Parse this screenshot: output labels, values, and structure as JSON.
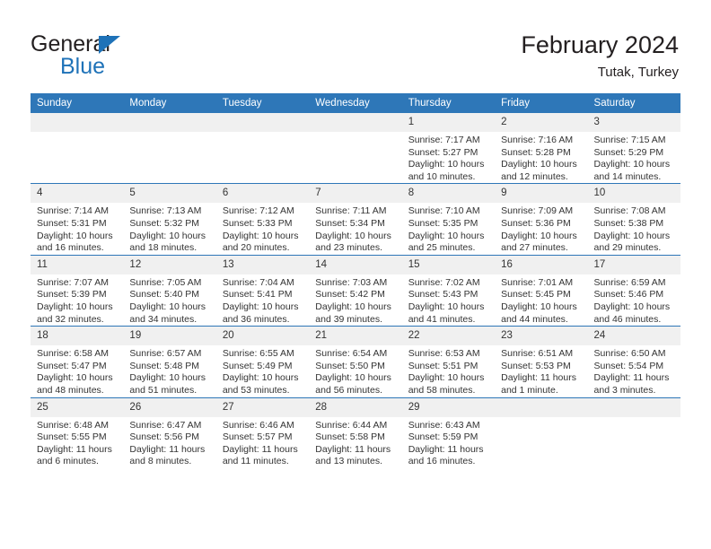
{
  "brand": {
    "name_top": "General",
    "name_bottom": "Blue"
  },
  "header": {
    "title": "February 2024",
    "subtitle": "Tutak, Turkey"
  },
  "colors": {
    "header_blue": "#2E77B8",
    "brand_blue": "#1E72B8",
    "daynum_band": "#F0F0F0",
    "text": "#333333"
  },
  "calendar": {
    "weekday_headers": [
      "Sunday",
      "Monday",
      "Tuesday",
      "Wednesday",
      "Thursday",
      "Friday",
      "Saturday"
    ],
    "weeks": [
      [
        {
          "day": "",
          "lines": []
        },
        {
          "day": "",
          "lines": []
        },
        {
          "day": "",
          "lines": []
        },
        {
          "day": "",
          "lines": []
        },
        {
          "day": "1",
          "lines": [
            "Sunrise: 7:17 AM",
            "Sunset: 5:27 PM",
            "Daylight: 10 hours",
            "and 10 minutes."
          ]
        },
        {
          "day": "2",
          "lines": [
            "Sunrise: 7:16 AM",
            "Sunset: 5:28 PM",
            "Daylight: 10 hours",
            "and 12 minutes."
          ]
        },
        {
          "day": "3",
          "lines": [
            "Sunrise: 7:15 AM",
            "Sunset: 5:29 PM",
            "Daylight: 10 hours",
            "and 14 minutes."
          ]
        }
      ],
      [
        {
          "day": "4",
          "lines": [
            "Sunrise: 7:14 AM",
            "Sunset: 5:31 PM",
            "Daylight: 10 hours",
            "and 16 minutes."
          ]
        },
        {
          "day": "5",
          "lines": [
            "Sunrise: 7:13 AM",
            "Sunset: 5:32 PM",
            "Daylight: 10 hours",
            "and 18 minutes."
          ]
        },
        {
          "day": "6",
          "lines": [
            "Sunrise: 7:12 AM",
            "Sunset: 5:33 PM",
            "Daylight: 10 hours",
            "and 20 minutes."
          ]
        },
        {
          "day": "7",
          "lines": [
            "Sunrise: 7:11 AM",
            "Sunset: 5:34 PM",
            "Daylight: 10 hours",
            "and 23 minutes."
          ]
        },
        {
          "day": "8",
          "lines": [
            "Sunrise: 7:10 AM",
            "Sunset: 5:35 PM",
            "Daylight: 10 hours",
            "and 25 minutes."
          ]
        },
        {
          "day": "9",
          "lines": [
            "Sunrise: 7:09 AM",
            "Sunset: 5:36 PM",
            "Daylight: 10 hours",
            "and 27 minutes."
          ]
        },
        {
          "day": "10",
          "lines": [
            "Sunrise: 7:08 AM",
            "Sunset: 5:38 PM",
            "Daylight: 10 hours",
            "and 29 minutes."
          ]
        }
      ],
      [
        {
          "day": "11",
          "lines": [
            "Sunrise: 7:07 AM",
            "Sunset: 5:39 PM",
            "Daylight: 10 hours",
            "and 32 minutes."
          ]
        },
        {
          "day": "12",
          "lines": [
            "Sunrise: 7:05 AM",
            "Sunset: 5:40 PM",
            "Daylight: 10 hours",
            "and 34 minutes."
          ]
        },
        {
          "day": "13",
          "lines": [
            "Sunrise: 7:04 AM",
            "Sunset: 5:41 PM",
            "Daylight: 10 hours",
            "and 36 minutes."
          ]
        },
        {
          "day": "14",
          "lines": [
            "Sunrise: 7:03 AM",
            "Sunset: 5:42 PM",
            "Daylight: 10 hours",
            "and 39 minutes."
          ]
        },
        {
          "day": "15",
          "lines": [
            "Sunrise: 7:02 AM",
            "Sunset: 5:43 PM",
            "Daylight: 10 hours",
            "and 41 minutes."
          ]
        },
        {
          "day": "16",
          "lines": [
            "Sunrise: 7:01 AM",
            "Sunset: 5:45 PM",
            "Daylight: 10 hours",
            "and 44 minutes."
          ]
        },
        {
          "day": "17",
          "lines": [
            "Sunrise: 6:59 AM",
            "Sunset: 5:46 PM",
            "Daylight: 10 hours",
            "and 46 minutes."
          ]
        }
      ],
      [
        {
          "day": "18",
          "lines": [
            "Sunrise: 6:58 AM",
            "Sunset: 5:47 PM",
            "Daylight: 10 hours",
            "and 48 minutes."
          ]
        },
        {
          "day": "19",
          "lines": [
            "Sunrise: 6:57 AM",
            "Sunset: 5:48 PM",
            "Daylight: 10 hours",
            "and 51 minutes."
          ]
        },
        {
          "day": "20",
          "lines": [
            "Sunrise: 6:55 AM",
            "Sunset: 5:49 PM",
            "Daylight: 10 hours",
            "and 53 minutes."
          ]
        },
        {
          "day": "21",
          "lines": [
            "Sunrise: 6:54 AM",
            "Sunset: 5:50 PM",
            "Daylight: 10 hours",
            "and 56 minutes."
          ]
        },
        {
          "day": "22",
          "lines": [
            "Sunrise: 6:53 AM",
            "Sunset: 5:51 PM",
            "Daylight: 10 hours",
            "and 58 minutes."
          ]
        },
        {
          "day": "23",
          "lines": [
            "Sunrise: 6:51 AM",
            "Sunset: 5:53 PM",
            "Daylight: 11 hours",
            "and 1 minute."
          ]
        },
        {
          "day": "24",
          "lines": [
            "Sunrise: 6:50 AM",
            "Sunset: 5:54 PM",
            "Daylight: 11 hours",
            "and 3 minutes."
          ]
        }
      ],
      [
        {
          "day": "25",
          "lines": [
            "Sunrise: 6:48 AM",
            "Sunset: 5:55 PM",
            "Daylight: 11 hours",
            "and 6 minutes."
          ]
        },
        {
          "day": "26",
          "lines": [
            "Sunrise: 6:47 AM",
            "Sunset: 5:56 PM",
            "Daylight: 11 hours",
            "and 8 minutes."
          ]
        },
        {
          "day": "27",
          "lines": [
            "Sunrise: 6:46 AM",
            "Sunset: 5:57 PM",
            "Daylight: 11 hours",
            "and 11 minutes."
          ]
        },
        {
          "day": "28",
          "lines": [
            "Sunrise: 6:44 AM",
            "Sunset: 5:58 PM",
            "Daylight: 11 hours",
            "and 13 minutes."
          ]
        },
        {
          "day": "29",
          "lines": [
            "Sunrise: 6:43 AM",
            "Sunset: 5:59 PM",
            "Daylight: 11 hours",
            "and 16 minutes."
          ]
        },
        {
          "day": "",
          "lines": []
        },
        {
          "day": "",
          "lines": []
        }
      ]
    ]
  }
}
